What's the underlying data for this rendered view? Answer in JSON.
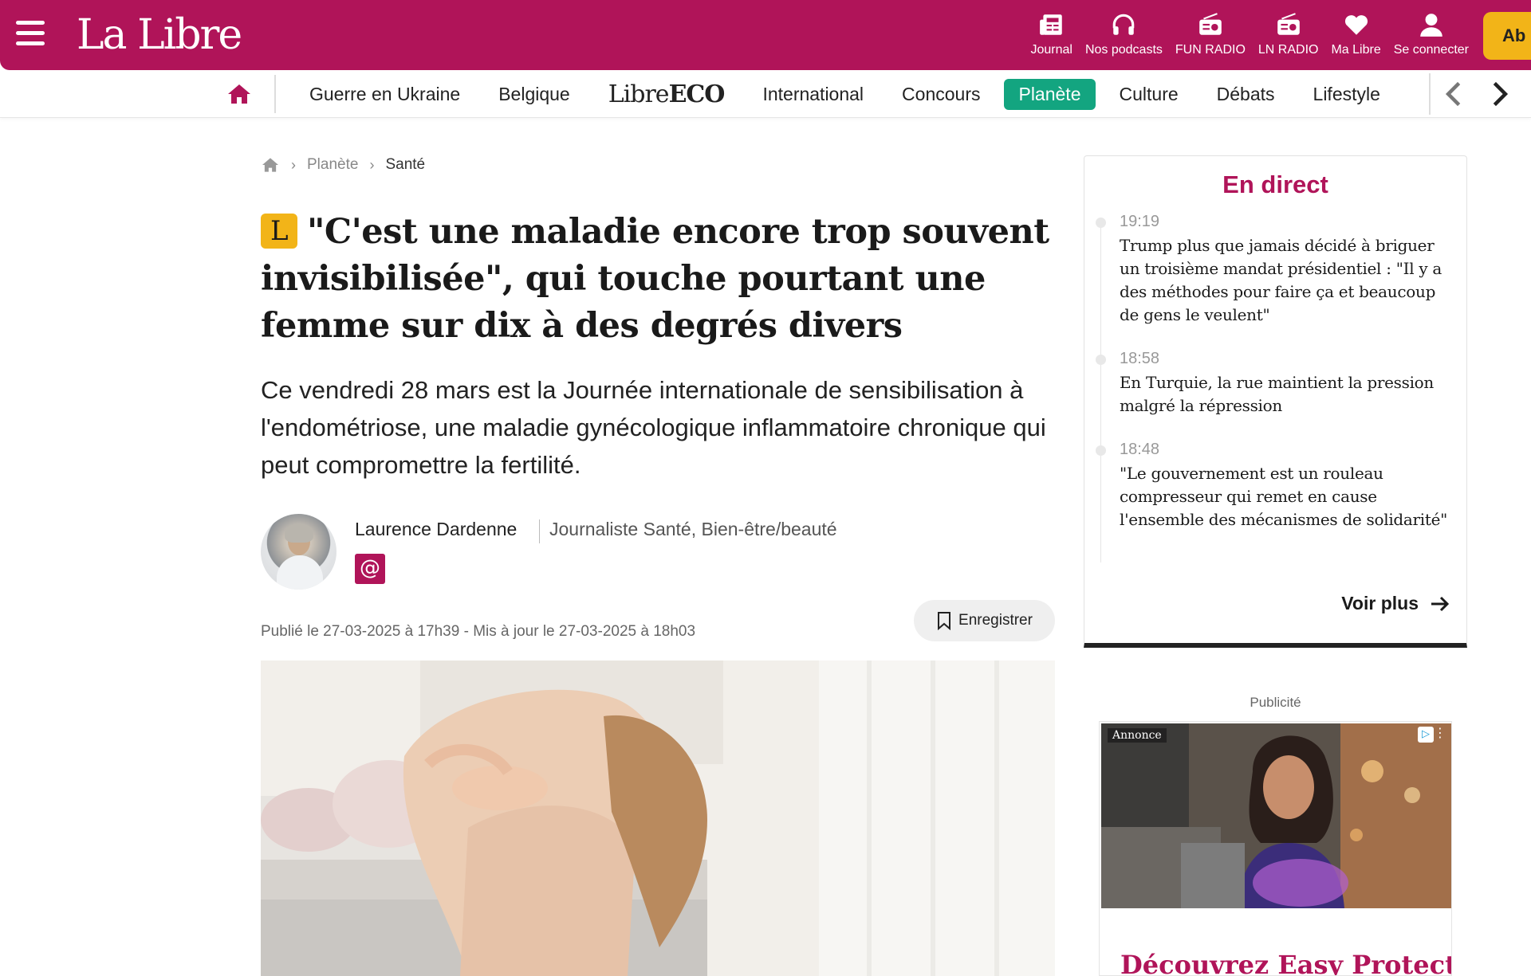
{
  "site": {
    "logo": "La Libre",
    "brand_color": "#b01459",
    "accent_green": "#13a580",
    "premium_color": "#f2b418"
  },
  "topbar": {
    "menu_icon": "hamburger-icon",
    "actions": [
      {
        "label": "Journal",
        "icon": "newspaper-icon"
      },
      {
        "label": "Nos podcasts",
        "icon": "headphones-icon"
      },
      {
        "label": "FUN RADIO",
        "icon": "radio-icon"
      },
      {
        "label": "LN RADIO",
        "icon": "radio-icon"
      },
      {
        "label": "Ma Libre",
        "icon": "heart-icon"
      },
      {
        "label": "Se connecter",
        "icon": "user-icon"
      }
    ],
    "subscribe_label": "Ab"
  },
  "nav": {
    "home_icon": "home-icon",
    "items": [
      {
        "label": "Guerre en Ukraine"
      },
      {
        "label": "Belgique"
      },
      {
        "label_a": "Libre",
        "label_b": "ECO"
      },
      {
        "label": "International"
      },
      {
        "label": "Concours"
      },
      {
        "label": "Planète",
        "active": true
      },
      {
        "label": "Culture"
      },
      {
        "label": "Débats"
      },
      {
        "label": "Lifestyle"
      }
    ]
  },
  "breadcrumb": {
    "items": [
      "Planète",
      "Santé"
    ]
  },
  "article": {
    "premium_badge": "L",
    "headline": "\"C'est une maladie encore trop souvent invisibilisée\", qui touche pourtant une femme sur dix à des degrés divers",
    "lead": "Ce vendredi 28 mars est la Journée internationale de sensibilisation à l'endométriose, une maladie gynécologique inflammatoire chronique qui peut compromettre la fertilité.",
    "author": {
      "name": "Laurence Dardenne",
      "role": "Journaliste Santé, Bien-être/beauté",
      "email_icon": "@"
    },
    "published": "Publié le 27-03-2025 à 17h39",
    "date_sep": "-",
    "updated": "Mis à jour le 27-03-2025 à 18h03",
    "save_label": "Enregistrer"
  },
  "live": {
    "title": "En direct",
    "items": [
      {
        "time": "19:19",
        "text": "Trump plus que jamais décidé à briguer un troisième mandat présidentiel : \"Il y a des méthodes pour faire ça et beaucoup de gens le veulent\""
      },
      {
        "time": "18:58",
        "text": "En Turquie, la rue maintient la pression malgré la répression"
      },
      {
        "time": "18:48",
        "text": "\"Le gouvernement est un rouleau compresseur qui remet en cause l'ensemble des mécanismes de solidarité\""
      }
    ],
    "more_label": "Voir plus"
  },
  "ad": {
    "label": "Publicité",
    "tag": "Annonce",
    "choice_icon": "▷",
    "menu_icon": "⋮",
    "headline": "Découvrez Easy Protect"
  }
}
